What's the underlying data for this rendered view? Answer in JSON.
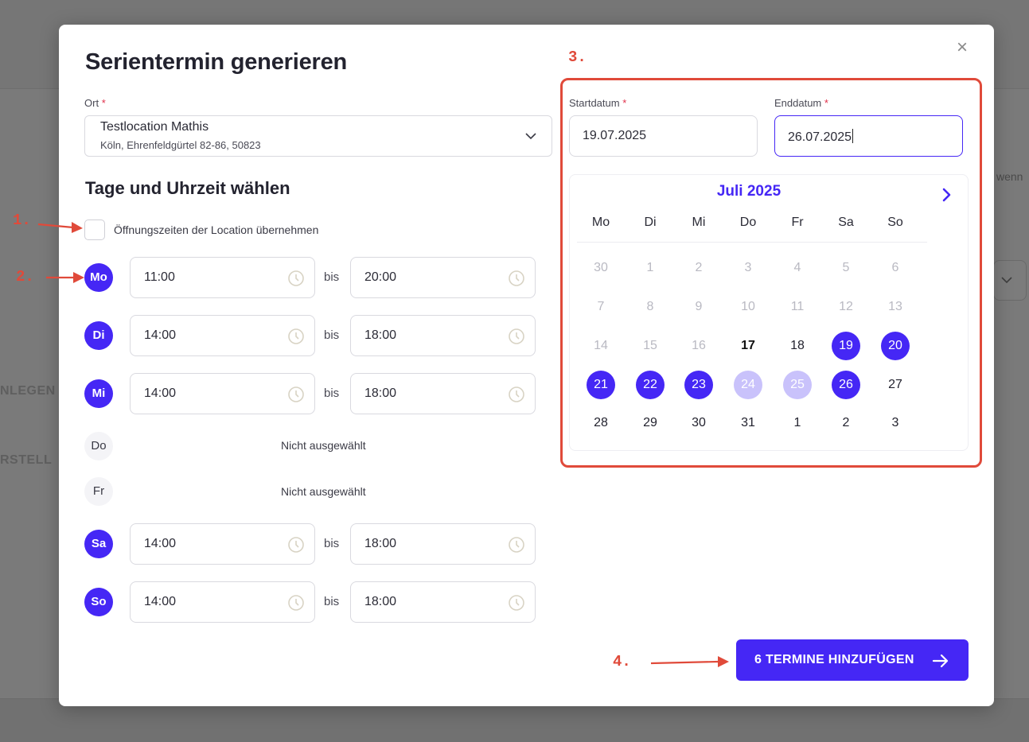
{
  "background": {
    "text_anlegen": "NLEGEN",
    "text_erstellen": "RSTELL",
    "text_wenn": "wenn"
  },
  "modal": {
    "title": "Serientermin generieren",
    "close_symbol": "×",
    "ort": {
      "label": "Ort",
      "required_mark": "*",
      "name": "Testlocation Mathis",
      "address": "Köln, Ehrenfeldgürtel 82-86, 50823"
    },
    "section_title": "Tage und Uhrzeit wählen",
    "opening_hours_checkbox": {
      "label": "Öffnungszeiten der Location übernehmen",
      "checked": false
    },
    "bis_label": "bis",
    "not_selected_label": "Nicht ausgewählt",
    "days": [
      {
        "short": "Mo",
        "active": true,
        "from": "11:00",
        "to": "20:00"
      },
      {
        "short": "Di",
        "active": true,
        "from": "14:00",
        "to": "18:00"
      },
      {
        "short": "Mi",
        "active": true,
        "from": "14:00",
        "to": "18:00"
      },
      {
        "short": "Do",
        "active": false,
        "status": "Nicht ausgewählt"
      },
      {
        "short": "Fr",
        "active": false,
        "status": "Nicht ausgewählt"
      },
      {
        "short": "Sa",
        "active": true,
        "from": "14:00",
        "to": "18:00"
      },
      {
        "short": "So",
        "active": true,
        "from": "14:00",
        "to": "18:00"
      }
    ],
    "start_date": {
      "label": "Startdatum",
      "required_mark": "*",
      "value": "19.07.2025"
    },
    "end_date": {
      "label": "Enddatum",
      "required_mark": "*",
      "value": "26.07.2025"
    },
    "calendar": {
      "month_label": "Juli 2025",
      "weekdays": [
        "Mo",
        "Di",
        "Mi",
        "Do",
        "Fr",
        "Sa",
        "So"
      ],
      "weeks": [
        [
          "30",
          "1",
          "2",
          "3",
          "4",
          "5",
          "6"
        ],
        [
          "7",
          "8",
          "9",
          "10",
          "11",
          "12",
          "13"
        ],
        [
          "14",
          "15",
          "16",
          "17",
          "18",
          "19",
          "20"
        ],
        [
          "21",
          "22",
          "23",
          "24",
          "25",
          "26",
          "27"
        ],
        [
          "28",
          "29",
          "30",
          "31",
          "1",
          "2",
          "3"
        ]
      ],
      "states": [
        [
          "past",
          "past",
          "past",
          "past",
          "past",
          "past",
          "past"
        ],
        [
          "past",
          "past",
          "past",
          "past",
          "past",
          "past",
          "past"
        ],
        [
          "past",
          "past",
          "past",
          "today",
          "normal",
          "selected",
          "selected"
        ],
        [
          "selected",
          "selected",
          "selected",
          "light",
          "light",
          "selected",
          "normal"
        ],
        [
          "normal",
          "normal",
          "normal",
          "normal",
          "normal",
          "normal",
          "normal"
        ]
      ]
    },
    "submit_button": {
      "label": "6 TERMINE HINZUFÜGEN"
    }
  },
  "annotations": {
    "step1": "1.",
    "step2": "2.",
    "step3": "3.",
    "step4": "4.",
    "color": "#e04a3a"
  },
  "colors": {
    "accent": "#4527f5",
    "accent_light": "#c9c2fb",
    "required": "#e0314b"
  }
}
